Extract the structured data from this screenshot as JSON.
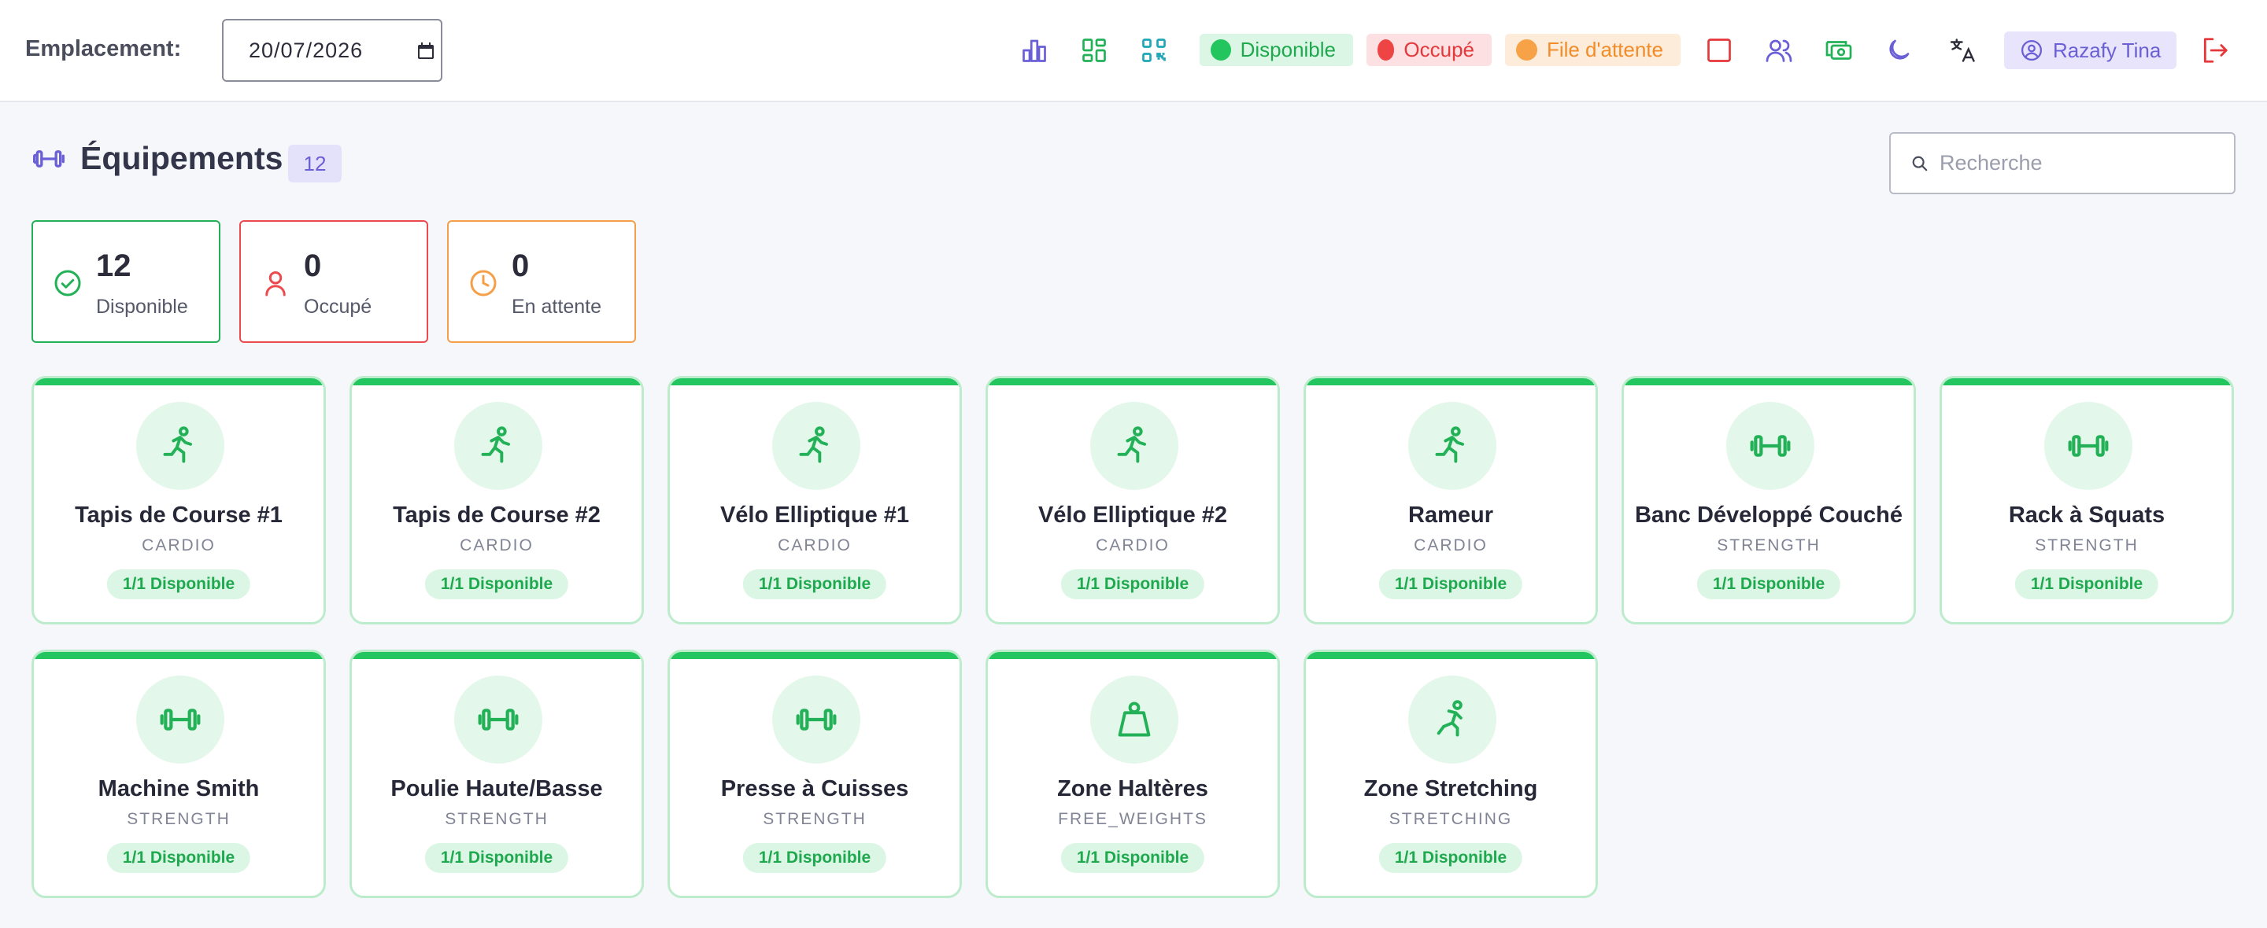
{
  "toolbar": {
    "location_label": "Emplacement:",
    "date_value": "20/07/2026",
    "legend": {
      "available": "Disponible",
      "busy": "Occupé",
      "queue": "File d'attente"
    },
    "user_name": "Razafy Tina",
    "icons": [
      "bar-chart-icon",
      "grid-icon",
      "qr-code-icon",
      "square-icon",
      "users-icon",
      "cash-icon",
      "moon-icon",
      "translate-icon",
      "logout-icon"
    ]
  },
  "header": {
    "title": "Équipements",
    "count": "12",
    "search_placeholder": "Recherche"
  },
  "stats": {
    "available": {
      "value": "12",
      "label": "Disponible"
    },
    "busy": {
      "value": "0",
      "label": "Occupé"
    },
    "waiting": {
      "value": "0",
      "label": "En attente"
    }
  },
  "equipment": [
    {
      "name": "Tapis de Course #1",
      "category": "CARDIO",
      "status": "1/1 Disponible",
      "icon": "running-icon"
    },
    {
      "name": "Tapis de Course #2",
      "category": "CARDIO",
      "status": "1/1 Disponible",
      "icon": "running-icon"
    },
    {
      "name": "Vélo Elliptique #1",
      "category": "CARDIO",
      "status": "1/1 Disponible",
      "icon": "running-icon"
    },
    {
      "name": "Vélo Elliptique #2",
      "category": "CARDIO",
      "status": "1/1 Disponible",
      "icon": "running-icon"
    },
    {
      "name": "Rameur",
      "category": "CARDIO",
      "status": "1/1 Disponible",
      "icon": "running-icon"
    },
    {
      "name": "Banc Développé Couché",
      "category": "STRENGTH",
      "status": "1/1 Disponible",
      "icon": "dumbbell-icon"
    },
    {
      "name": "Rack à Squats",
      "category": "STRENGTH",
      "status": "1/1 Disponible",
      "icon": "dumbbell-icon"
    },
    {
      "name": "Machine Smith",
      "category": "STRENGTH",
      "status": "1/1 Disponible",
      "icon": "dumbbell-icon"
    },
    {
      "name": "Poulie Haute/Basse",
      "category": "STRENGTH",
      "status": "1/1 Disponible",
      "icon": "dumbbell-icon"
    },
    {
      "name": "Presse à Cuisses",
      "category": "STRENGTH",
      "status": "1/1 Disponible",
      "icon": "dumbbell-icon"
    },
    {
      "name": "Zone Haltères",
      "category": "FREE_WEIGHTS",
      "status": "1/1 Disponible",
      "icon": "weight-icon"
    },
    {
      "name": "Zone Stretching",
      "category": "STRETCHING",
      "status": "1/1 Disponible",
      "icon": "stretching-icon"
    }
  ],
  "colors": {
    "available": "#22c55e",
    "busy": "#ef4444",
    "queue": "#f7a247",
    "accent": "#6a5fd6"
  }
}
